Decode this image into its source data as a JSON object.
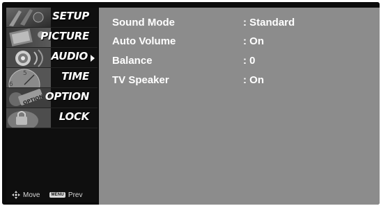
{
  "sidebar": {
    "items": [
      {
        "label": "SETUP",
        "icon": "setup-thumbnail-icon",
        "selected": false
      },
      {
        "label": "PICTURE",
        "icon": "picture-thumbnail-icon",
        "selected": false
      },
      {
        "label": "AUDIO",
        "icon": "audio-thumbnail-icon",
        "selected": true
      },
      {
        "label": "TIME",
        "icon": "time-thumbnail-icon",
        "selected": false
      },
      {
        "label": "OPTION",
        "icon": "option-thumbnail-icon",
        "selected": false
      },
      {
        "label": "LOCK",
        "icon": "lock-thumbnail-icon",
        "selected": false
      }
    ],
    "hints": {
      "move_label": "Move",
      "menu_key": "MENU",
      "prev_label": "Prev"
    }
  },
  "audio": {
    "rows": [
      {
        "name": "Sound Mode",
        "value": ": Standard"
      },
      {
        "name": "Auto Volume",
        "value": ": On"
      },
      {
        "name": "Balance",
        "value": ": 0"
      },
      {
        "name": "TV Speaker",
        "value": ": On"
      }
    ]
  },
  "colors": {
    "content_bg": "#8c8c8c",
    "sidebar_bg": "#0f0f0f",
    "text": "#ffffff"
  }
}
